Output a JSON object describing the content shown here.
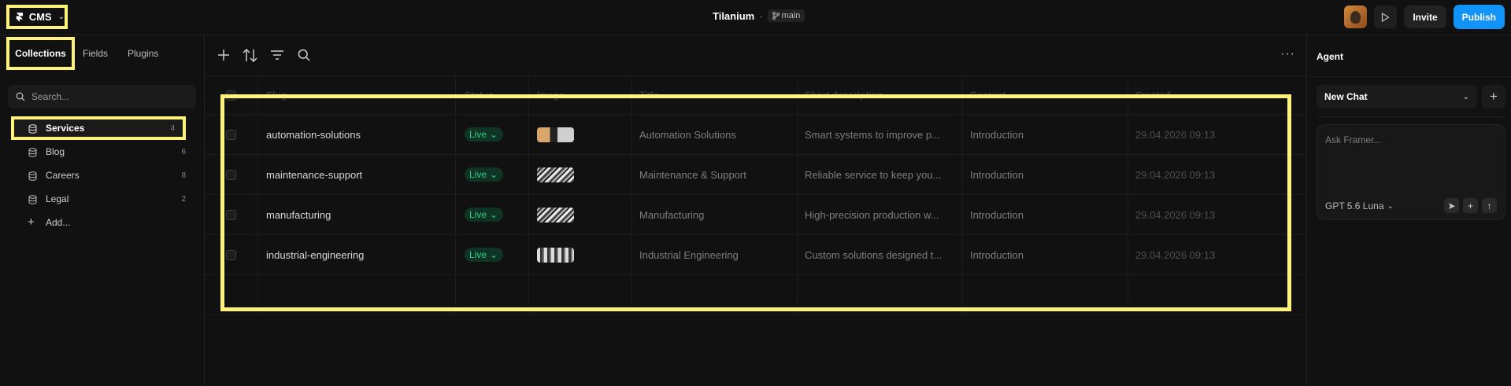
{
  "topbar": {
    "app_label": "CMS",
    "project_name": "Tilanium",
    "separator": "·",
    "branch": "main",
    "invite_label": "Invite",
    "publish_label": "Publish"
  },
  "sidebar": {
    "tabs": [
      {
        "label": "Collections"
      },
      {
        "label": "Fields"
      },
      {
        "label": "Plugins"
      }
    ],
    "search_placeholder": "Search...",
    "collections": [
      {
        "label": "Services",
        "count": "4"
      },
      {
        "label": "Blog",
        "count": "6"
      },
      {
        "label": "Careers",
        "count": "8"
      },
      {
        "label": "Legal",
        "count": "2"
      }
    ],
    "add_label": "Add..."
  },
  "table": {
    "columns": [
      "Slug",
      "Status",
      "Image",
      "Title",
      "Short description",
      "Content",
      "Created"
    ],
    "rows": [
      {
        "slug": "automation-solutions",
        "status": "Live",
        "title": "Automation Solutions",
        "short": "Smart systems to improve p...",
        "content": "Introduction",
        "created": "29.04.2026 09:13"
      },
      {
        "slug": "maintenance-support",
        "status": "Live",
        "title": "Maintenance & Support",
        "short": "Reliable service to keep you...",
        "content": "Introduction",
        "created": "29.04.2026 09:13"
      },
      {
        "slug": "manufacturing",
        "status": "Live",
        "title": "Manufacturing",
        "short": "High-precision production w...",
        "content": "Introduction",
        "created": "29.04.2026 09:13"
      },
      {
        "slug": "industrial-engineering",
        "status": "Live",
        "title": "Industrial Engineering",
        "short": "Custom solutions designed t...",
        "content": "Introduction",
        "created": "29.04.2026 09:13"
      }
    ]
  },
  "agent": {
    "title": "Agent",
    "chat_label": "New Chat",
    "prompt_placeholder": "Ask Framer...",
    "model": "GPT 5.6 Luna"
  },
  "colors": {
    "accent": "#1293f7",
    "highlight": "#fdf27a",
    "live": "#30d183",
    "background": "#111111"
  }
}
